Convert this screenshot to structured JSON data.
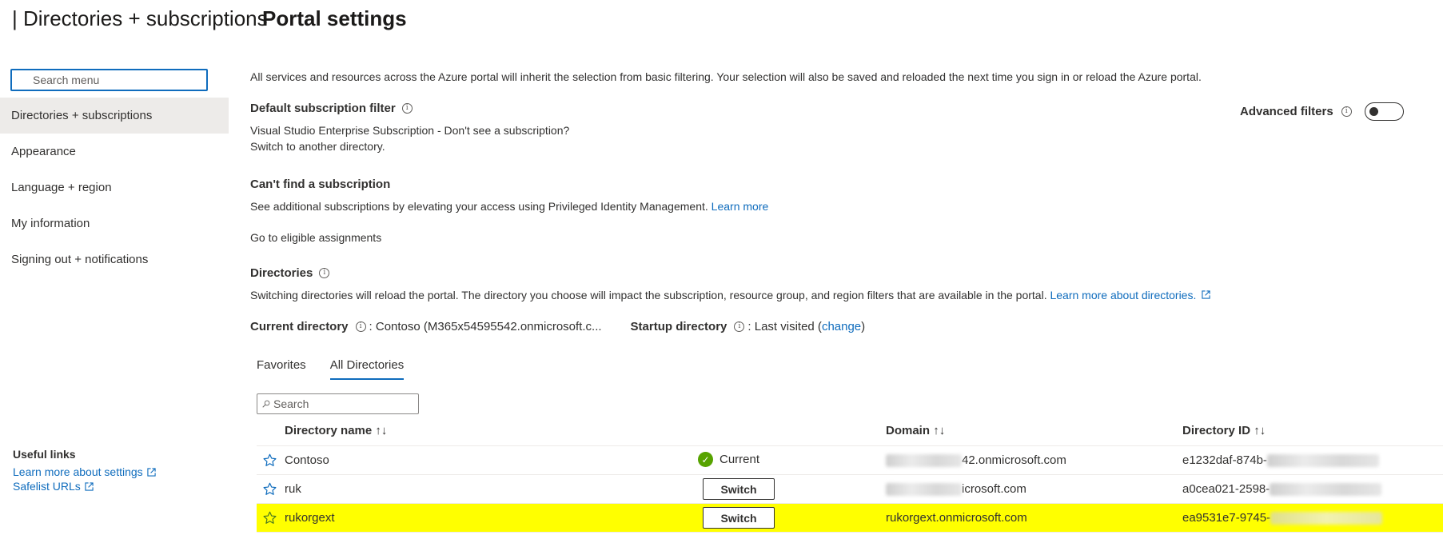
{
  "header": {
    "title": "Portal settings",
    "separator": "|",
    "subtitle": "Directories + subscriptions"
  },
  "sidebar": {
    "search_placeholder": "Search menu",
    "items": [
      {
        "label": "Directories + subscriptions",
        "active": true
      },
      {
        "label": "Appearance"
      },
      {
        "label": "Language + region"
      },
      {
        "label": "My information"
      },
      {
        "label": "Signing out + notifications"
      }
    ],
    "useful_links": {
      "heading": "Useful links",
      "links": [
        "Learn more about settings",
        "Safelist URLs"
      ]
    }
  },
  "main": {
    "intro": "All services and resources across the Azure portal will inherit the selection from basic filtering. Your selection will also be saved and reloaded the next time you sign in or reload the Azure portal.",
    "default_filter": {
      "title": "Default subscription filter",
      "line1": "Visual Studio Enterprise Subscription - Don't see a subscription?",
      "line2": "Switch to another directory."
    },
    "advanced_filters": {
      "label": "Advanced filters",
      "enabled": false
    },
    "cant_find": {
      "title": "Can't find a subscription",
      "text": "See additional subscriptions by elevating your access using Privileged Identity Management.",
      "learn_more": "Learn more",
      "eligible_link": "Go to eligible assignments"
    },
    "directories": {
      "title": "Directories",
      "text": "Switching directories will reload the portal. The directory you choose will impact the subscription, resource group, and region filters that are available in the portal.",
      "learn_more": "Learn more about directories.",
      "current_label": "Current directory",
      "current_value": ": Contoso (M365x54595542.onmicrosoft.c...",
      "startup_label": "Startup directory",
      "startup_value_prefix": ": Last visited (",
      "startup_change": "change",
      "startup_value_suffix": ")"
    },
    "tabs": [
      {
        "label": "Favorites",
        "active": false
      },
      {
        "label": "All Directories",
        "active": true
      }
    ],
    "table_search_placeholder": "Search",
    "table": {
      "columns": [
        "Directory name",
        "Domain",
        "Directory ID"
      ],
      "sort_glyph": "↑↓",
      "rows": [
        {
          "name": "Contoso",
          "status": "Current",
          "action": "",
          "domain_suffix": "42.onmicrosoft.com",
          "id_prefix": "e1232daf-874b-",
          "highlight": false
        },
        {
          "name": "ruk",
          "status": "",
          "action": "Switch",
          "domain_suffix": "icrosoft.com",
          "id_prefix": "a0cea021-2598-",
          "highlight": false
        },
        {
          "name": "rukorgext",
          "status": "",
          "action": "Switch",
          "domain_suffix": "rukorgext.onmicrosoft.com",
          "id_prefix": "ea9531e7-9745-",
          "highlight": true
        }
      ]
    }
  },
  "colors": {
    "link": "#0f6cbd",
    "highlight": "#ffff00",
    "current_check": "#57a300",
    "active_nav": "#edebe9"
  }
}
